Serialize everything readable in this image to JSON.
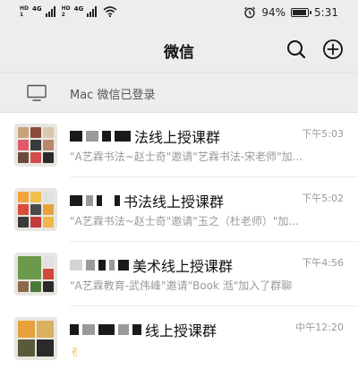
{
  "status": {
    "sim1_label": "HD",
    "sim1_net": "4G",
    "sim2_label": "HD",
    "sim2_net": "4G",
    "battery_percent": "94%",
    "battery_level": 0.94,
    "time": "5:31"
  },
  "header": {
    "title": "微信",
    "search_icon": "search-icon",
    "add_icon": "plus-circle-icon"
  },
  "login_bar": {
    "icon": "monitor-icon",
    "text": "Mac 微信已登录"
  },
  "chats": [
    {
      "name_visible": "法线上授课群",
      "time": "下午5:03",
      "preview": "\"A艺霖书法~赵士奇\"邀请\"艺霖书法-宋老师\"加..."
    },
    {
      "name_visible": "书法线上授课群",
      "time": "下午5:02",
      "preview": "\"A艺霖书法~赵士奇\"邀请\"玉之（杜老师）\"加..."
    },
    {
      "name_visible": "美术线上授课群",
      "time": "下午4:56",
      "preview": "\"A艺霖教育-武伟峰\"邀请\"Book 湉\"加入了群聊"
    },
    {
      "name_visible": "线上授课群",
      "time": "中午12:20",
      "preview": ""
    }
  ]
}
